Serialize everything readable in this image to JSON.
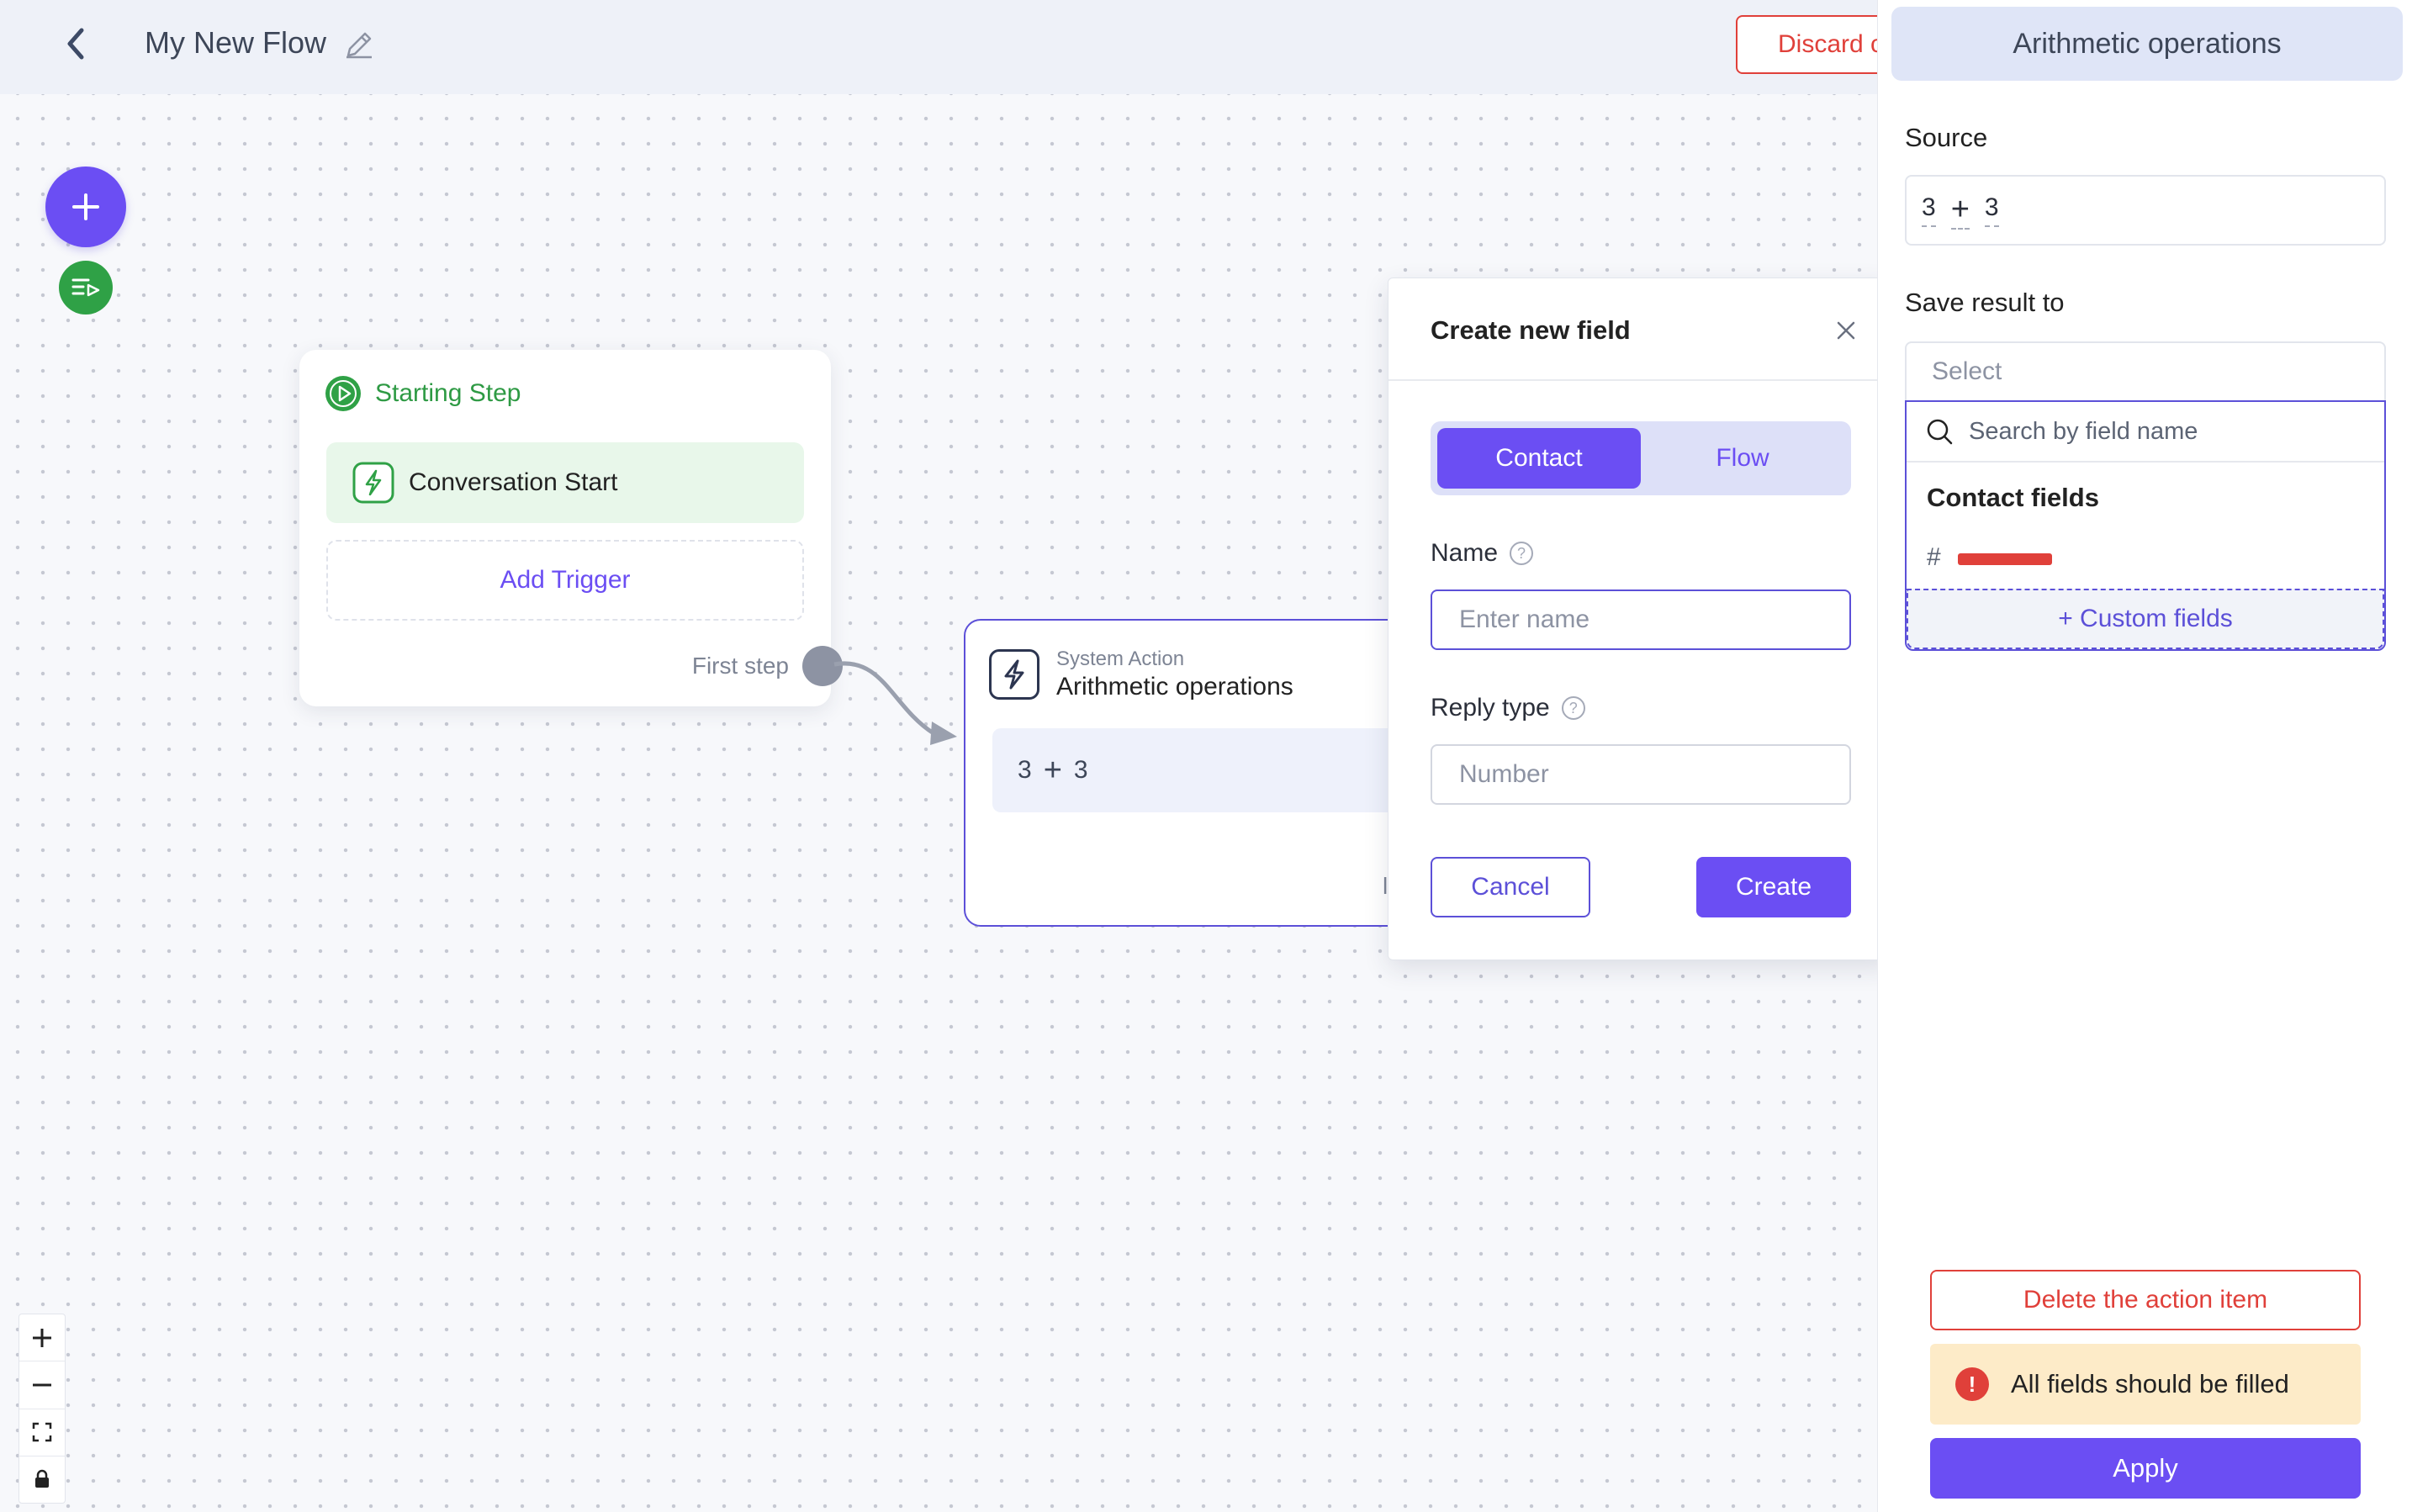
{
  "header": {
    "title": "My New Flow",
    "discard_label": "Discard c"
  },
  "start_card": {
    "title": "Starting Step",
    "trigger": "Conversation Start",
    "add_trigger": "Add Trigger",
    "first_step": "First step"
  },
  "action_card": {
    "subtitle": "System Action",
    "title": "Arithmetic operations",
    "expr_left": "3",
    "expr_op": "+",
    "expr_right": "3",
    "trail": "l"
  },
  "modal": {
    "title": "Create new field",
    "tabs": [
      {
        "label": "Contact",
        "active": true
      },
      {
        "label": "Flow",
        "active": false
      }
    ],
    "name_label": "Name",
    "name_placeholder": "Enter name",
    "reply_label": "Reply type",
    "reply_value": "Number",
    "help_glyph": "?",
    "cancel_label": "Cancel",
    "create_label": "Create"
  },
  "panel": {
    "title": "Arithmetic operations",
    "source_label": "Source",
    "source_left": "3",
    "source_op": "+",
    "source_right": "3",
    "save_label": "Save result to",
    "select_placeholder": "Select",
    "search_placeholder": "Search by field name",
    "group_label": "Contact fields",
    "field_hash": "#",
    "custom_fields": "+ Custom fields",
    "delete_label": "Delete the action item",
    "alert_glyph": "!",
    "alert_text": "All fields should be filled",
    "apply_label": "Apply"
  },
  "colors": {
    "accent": "#6b4ef3",
    "success": "#2fa146",
    "danger": "#e0403a",
    "warning_bg": "#fdebc8"
  }
}
